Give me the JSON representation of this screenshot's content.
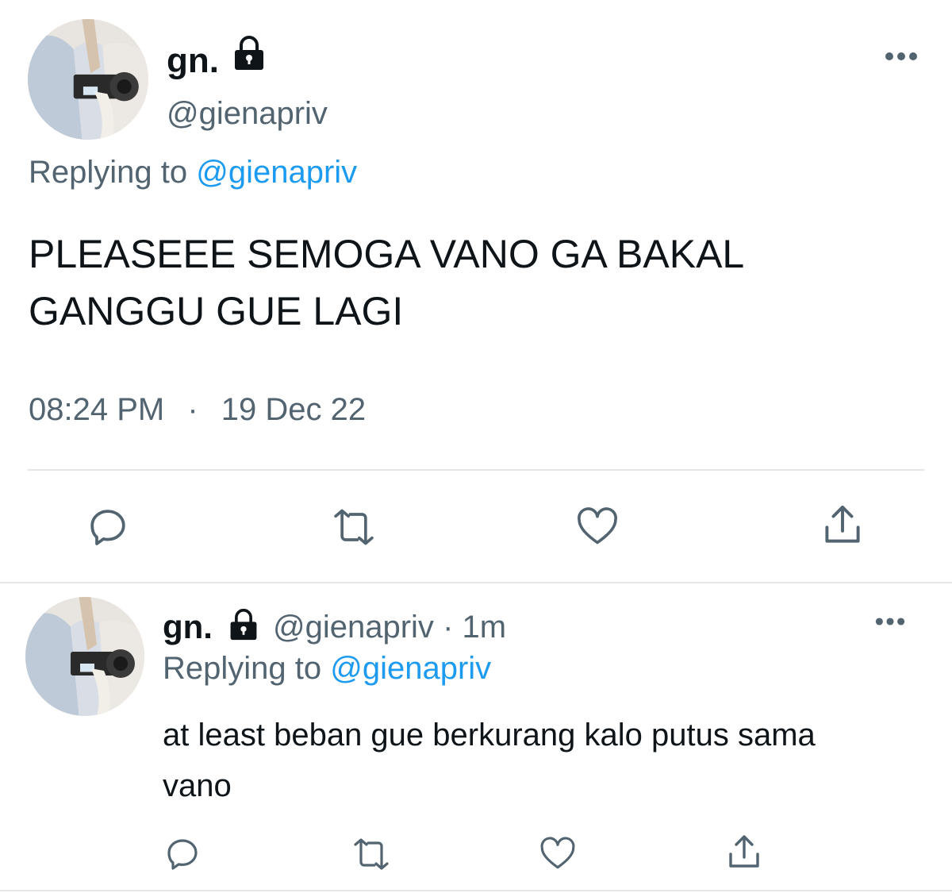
{
  "main_tweet": {
    "display_name": "gn.",
    "handle": "@gienapriv",
    "replying_prefix": "Replying to",
    "replying_handle": "@gienapriv",
    "text_line1": "PLEASEEE SEMOGA VANO GA BAKAL",
    "text_line2": "GANGGU GUE LAGI",
    "time": "08:24 PM",
    "separator": "·",
    "date": "19 Dec 22",
    "icons": {
      "lock": "lock-icon",
      "more": "more-icon",
      "reply": "reply-icon",
      "retweet": "retweet-icon",
      "like": "heart-icon",
      "share": "share-icon"
    }
  },
  "reply_tweet": {
    "display_name": "gn.",
    "handle": "@gienapriv",
    "age": "· 1m",
    "replying_prefix": "Replying to",
    "replying_handle": "@gienapriv",
    "text_line1": "at least beban gue berkurang kalo putus sama",
    "text_line2": "vano"
  },
  "colors": {
    "text": "#0f1419",
    "muted": "#536471",
    "link": "#1d9bf0",
    "divider": "#e6e6e6"
  }
}
